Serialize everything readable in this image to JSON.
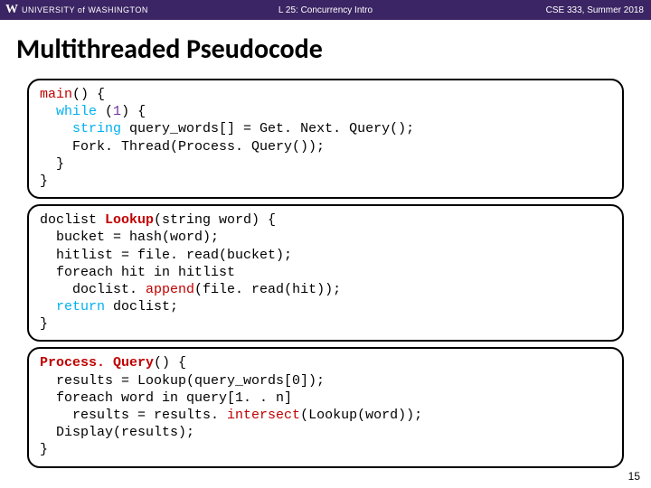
{
  "header": {
    "logo_w": "W",
    "university": "UNIVERSITY of WASHINGTON",
    "center": "L 25: Concurrency Intro",
    "right": "CSE 333, Summer 2018"
  },
  "title": "Multithreaded Pseudocode",
  "code": {
    "block1": {
      "l1_main": "main",
      "l1_rest": "() {",
      "l2_indent": "  ",
      "l2_while": "while",
      "l2_paren_open": " (",
      "l2_one": "1",
      "l2_paren_close": ") {",
      "l3_indent": "    ",
      "l3_string": "string",
      "l3_rest": " query_words[] = Get. Next. Query();",
      "l4": "    Fork. Thread(Process. Query());",
      "l5": "  }",
      "l6": "}"
    },
    "block2": {
      "l1_pre": "doclist ",
      "l1_lookup": "Lookup",
      "l1_post": "(string word) {",
      "l2": "  bucket = hash(word);",
      "l3": "  hitlist = file. read(bucket);",
      "l4": "  foreach hit in hitlist",
      "l5_pre": "    doclist. ",
      "l5_append": "append",
      "l5_post": "(file. read(hit));",
      "l6_indent": "  ",
      "l6_return": "return",
      "l6_post": " doclist;",
      "l7": "}"
    },
    "block3": {
      "l1_pq": "Process. Query",
      "l1_post": "() {",
      "l2": "  results = Lookup(query_words[0]);",
      "l3": "  foreach word in query[1. . n]",
      "l4_pre": "    results = results. ",
      "l4_intersect": "intersect",
      "l4_post": "(Lookup(word));",
      "l5": "  Display(results);",
      "l6": "}"
    }
  },
  "page_number": "15"
}
